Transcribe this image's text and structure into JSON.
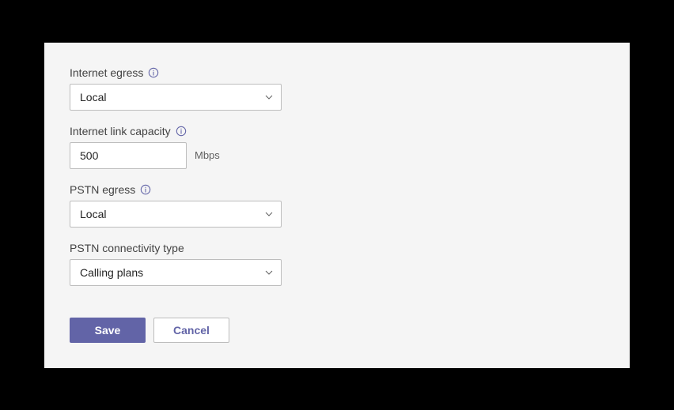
{
  "fields": {
    "internet_egress": {
      "label": "Internet egress",
      "value": "Local",
      "has_info": true
    },
    "internet_link_capacity": {
      "label": "Internet link capacity",
      "value": "500",
      "unit": "Mbps",
      "has_info": true
    },
    "pstn_egress": {
      "label": "PSTN egress",
      "value": "Local",
      "has_info": true
    },
    "pstn_connectivity_type": {
      "label": "PSTN connectivity type",
      "value": "Calling plans",
      "has_info": false
    }
  },
  "buttons": {
    "save": "Save",
    "cancel": "Cancel"
  },
  "colors": {
    "accent": "#6264a7",
    "panel_bg": "#f5f5f5"
  }
}
